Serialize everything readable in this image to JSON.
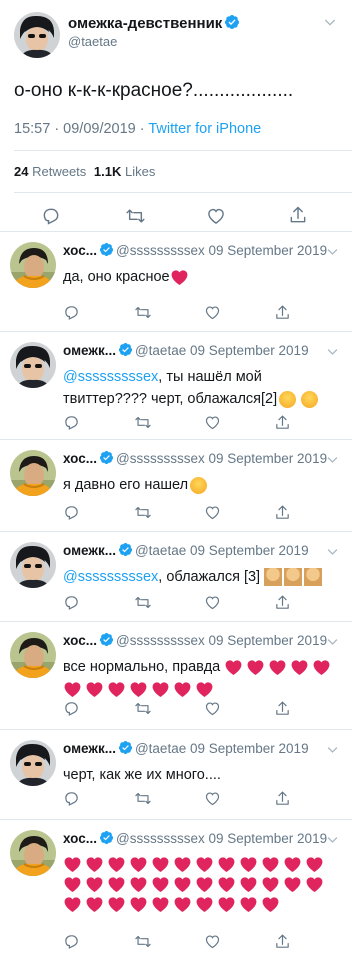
{
  "main_tweet": {
    "name": "омежка-девственник",
    "handle": "@taetae",
    "text": "о-оно к-к-к-красное?...................",
    "timestamp": "15:57 · 09/09/2019 · ",
    "source": "Twitter for iPhone",
    "retweets_count": "24",
    "retweets_label": "Retweets",
    "likes_count": "1.1K",
    "likes_label": "Likes"
  },
  "replies": [
    {
      "name": "хос...",
      "handle": "@sssssssssex",
      "date": "09 September 2019",
      "text": "да, оно красное",
      "heart_count": 1
    },
    {
      "name": "омежк...",
      "handle": "@taetae",
      "date": "09 September 2019",
      "mention": "@sssssssssex",
      "text": ", ты нашёл мой твиттер???? черт, облажался[2]"
    },
    {
      "name": "хос...",
      "handle": "@sssssssssex",
      "date": "09 September 2019",
      "text": "я давно его нашел"
    },
    {
      "name": "омежк...",
      "handle": "@taetae",
      "date": "09 September 2019",
      "mention": "@sssssssssex",
      "text": ", облажался [3]"
    },
    {
      "name": "хос...",
      "handle": "@sssssssssex",
      "date": "09 September 2019",
      "text": "все нормально, правда",
      "heart_count": 12
    },
    {
      "name": "омежк...",
      "handle": "@taetae",
      "date": "09 September 2019",
      "text": "черт, как же их много...."
    },
    {
      "name": "хос...",
      "handle": "@sssssssssex",
      "date": "09 September 2019",
      "text": "",
      "heart_count": 34
    }
  ],
  "colors": {
    "accent": "#1da1f2",
    "heart": "#e0245e",
    "secondary_text": "#657786",
    "divider": "#e1e8ed"
  },
  "icons": [
    "verified-icon",
    "chevron-down-icon",
    "reply-icon",
    "retweet-icon",
    "like-icon",
    "share-icon",
    "heart-emoji-icon",
    "sweat-smile-emoji-icon",
    "smirk-emoji-icon",
    "facepalm-emoji-icon"
  ]
}
